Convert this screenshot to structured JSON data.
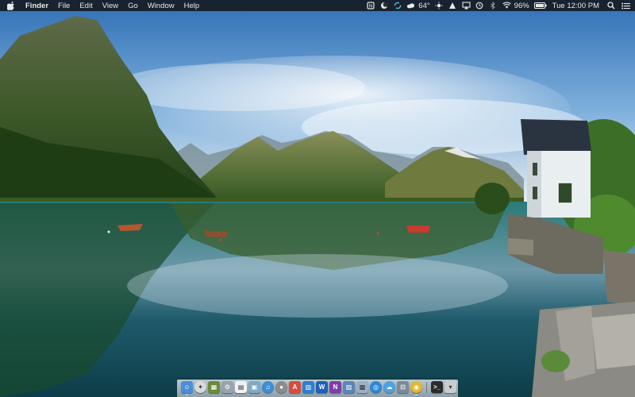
{
  "menubar": {
    "app_name": "Finder",
    "menus": [
      "File",
      "Edit",
      "View",
      "Go",
      "Window",
      "Help"
    ],
    "weather_temp": "64°",
    "battery_percent": "96%",
    "clock": "Tue 12:00 PM",
    "status_icons": [
      "notes-icon",
      "moon-icon",
      "sync-icon",
      "cloud-weather-icon",
      "sun-icon",
      "notification-icon",
      "airplay-icon",
      "time-machine-icon",
      "bluetooth-icon",
      "wifi-icon",
      "battery-icon",
      "search-icon",
      "notification-center-icon"
    ]
  },
  "dock": {
    "apps": [
      {
        "name": "finder-icon",
        "color": "#4a8fd8",
        "glyph": "☺"
      },
      {
        "name": "safari-compass-icon",
        "color": "#d9d9d9",
        "glyph": "✦"
      },
      {
        "name": "photo-browser-icon",
        "color": "#6b8a3a",
        "glyph": "▦"
      },
      {
        "name": "system-prefs-icon",
        "color": "#9aa3ab",
        "glyph": "⚙"
      },
      {
        "name": "calendar-icon",
        "color": "#f2f2f2",
        "glyph": "▤"
      },
      {
        "name": "photos-icon",
        "color": "#7fa9c7",
        "glyph": "▣"
      },
      {
        "name": "itunes-icon",
        "color": "#3d8ed6",
        "glyph": "♫"
      },
      {
        "name": "microphone-icon",
        "color": "#8c8c8c",
        "glyph": "●"
      },
      {
        "name": "app-store-icon",
        "color": "#d94b3b",
        "glyph": "A"
      },
      {
        "name": "calculator-icon",
        "color": "#2f7fd0",
        "glyph": "▥"
      },
      {
        "name": "word-icon",
        "color": "#1f5fb8",
        "glyph": "W"
      },
      {
        "name": "onenote-icon",
        "color": "#7d3fa8",
        "glyph": "N"
      },
      {
        "name": "preview-icon",
        "color": "#5d86b3",
        "glyph": "▨"
      },
      {
        "name": "image-capture-icon",
        "color": "#9bb0c4",
        "glyph": "▩"
      },
      {
        "name": "safari-icon",
        "color": "#2f86d6",
        "glyph": "◎"
      },
      {
        "name": "chat-icon",
        "color": "#4aa3e6",
        "glyph": "☁"
      },
      {
        "name": "screenshot-icon",
        "color": "#7a8a99",
        "glyph": "⊡"
      },
      {
        "name": "chrome-icon",
        "color": "#e5b62f",
        "glyph": "◉"
      },
      {
        "name": "terminal-icon",
        "color": "#2b2b2b",
        "glyph": ">_"
      },
      {
        "name": "trash-icon",
        "color": "#c9cdd1",
        "glyph": "▾"
      }
    ]
  },
  "colors": {
    "sky_top": "#3b7fc4",
    "sky_bottom": "#dfe9f1",
    "water_top": "#1d6b6e",
    "water_bottom": "#0b3a4a",
    "menubar": "#14161a"
  }
}
